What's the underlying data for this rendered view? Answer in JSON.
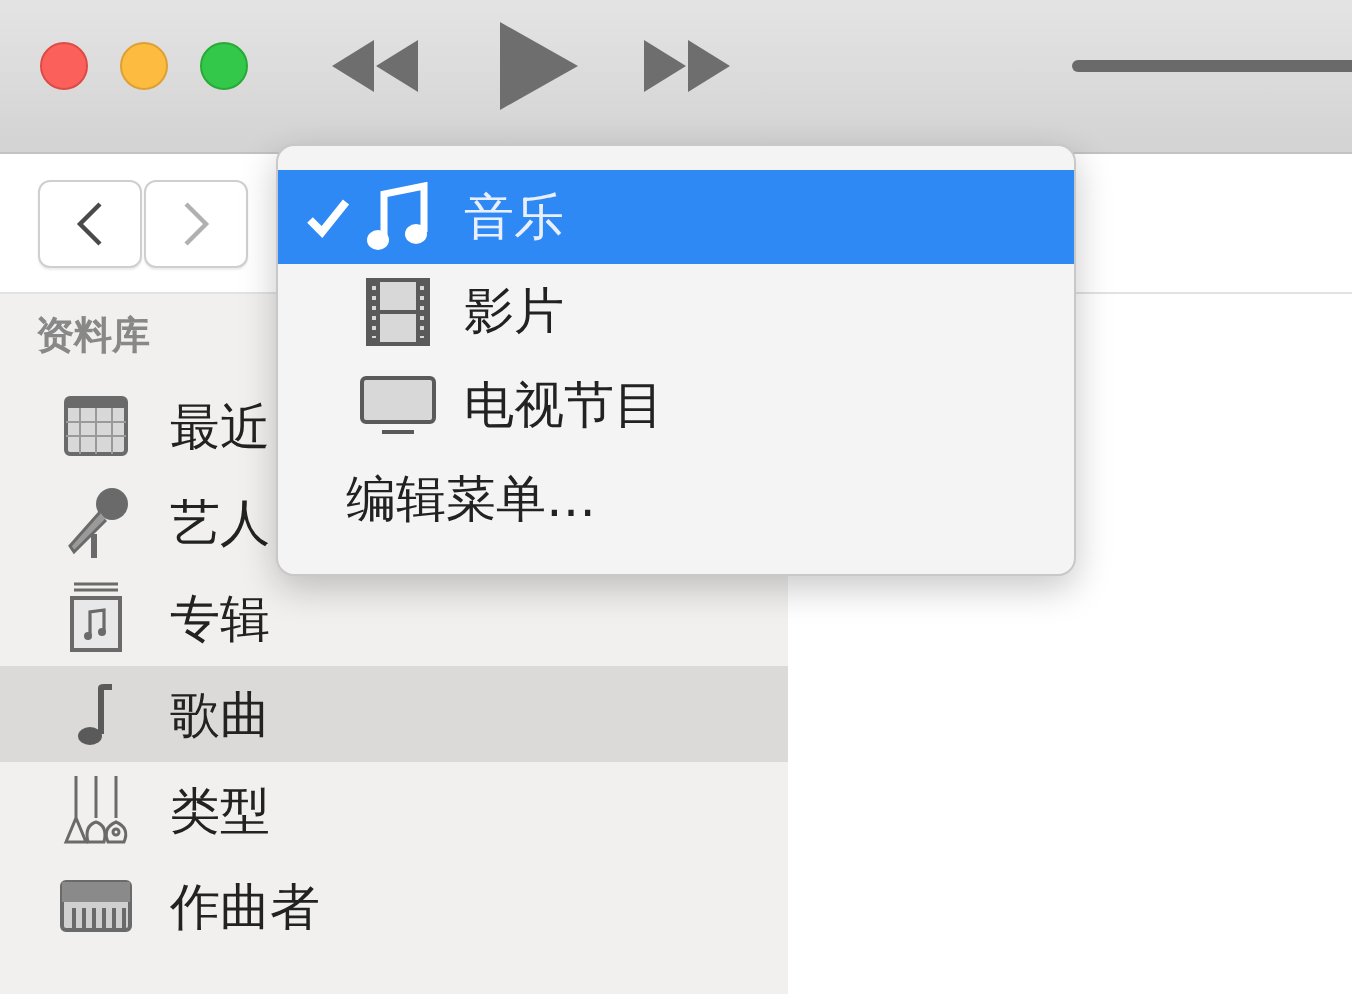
{
  "navigation": [
    {
      "kind": "back",
      "disabled": false
    },
    {
      "kind": "forward",
      "disabled": true
    }
  ],
  "sidebar": {
    "heading": "资料库",
    "items": [
      {
        "label": "最近",
        "kind": "grid",
        "selected": false
      },
      {
        "label": "艺人",
        "kind": "microphone",
        "selected": false
      },
      {
        "label": "专辑",
        "kind": "album",
        "selected": false
      },
      {
        "label": "歌曲",
        "kind": "note",
        "selected": true
      },
      {
        "label": "类型",
        "kind": "guitars",
        "selected": false
      },
      {
        "label": "作曲者",
        "kind": "piano",
        "selected": false
      }
    ]
  },
  "media_menu": {
    "items": [
      {
        "label": "音乐",
        "kind": "music",
        "checked": true,
        "selected": true
      },
      {
        "label": "影片",
        "kind": "film",
        "checked": false,
        "selected": false
      },
      {
        "label": "电视节目",
        "kind": "tv",
        "checked": false,
        "selected": false
      },
      {
        "label": "编辑菜单…",
        "kind": "plain",
        "selected": false
      }
    ]
  },
  "volume": {
    "level": 1
  }
}
